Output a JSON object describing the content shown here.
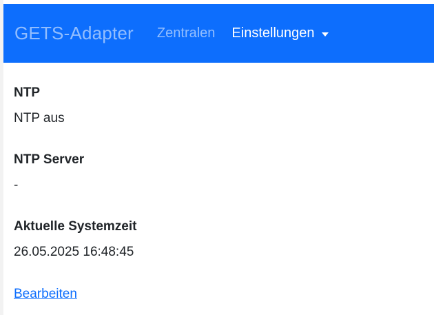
{
  "navbar": {
    "brand": "GETS-Adapter",
    "links": [
      "Zentralen"
    ],
    "dropdown_label": "Einstellungen",
    "background": "#0d6efd"
  },
  "settings": {
    "ntp": {
      "label": "NTP",
      "value": "NTP aus"
    },
    "ntp_server": {
      "label": "NTP Server",
      "value": "-"
    },
    "system_time": {
      "label": "Aktuelle Systemzeit",
      "value": "26.05.2025 16:48:45"
    }
  },
  "actions": {
    "edit_label": "Bearbeiten"
  }
}
